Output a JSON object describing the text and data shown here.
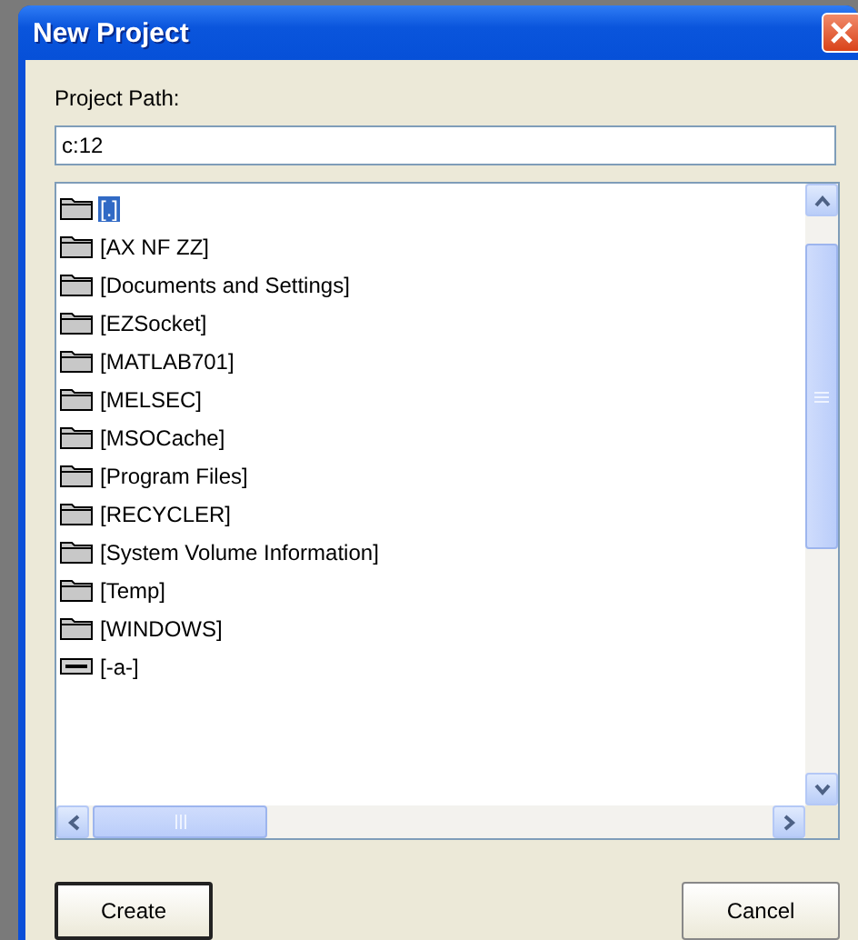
{
  "window": {
    "title": "New Project"
  },
  "path_field": {
    "label": "Project Path:",
    "value": "c:12"
  },
  "folders": [
    {
      "name": "[.]",
      "kind": "folder",
      "selected": true
    },
    {
      "name": "[AX NF ZZ]",
      "kind": "folder",
      "selected": false
    },
    {
      "name": "[Documents and Settings]",
      "kind": "folder",
      "selected": false
    },
    {
      "name": "[EZSocket]",
      "kind": "folder",
      "selected": false
    },
    {
      "name": "[MATLAB701]",
      "kind": "folder",
      "selected": false
    },
    {
      "name": "[MELSEC]",
      "kind": "folder",
      "selected": false
    },
    {
      "name": "[MSOCache]",
      "kind": "folder",
      "selected": false
    },
    {
      "name": "[Program Files]",
      "kind": "folder",
      "selected": false
    },
    {
      "name": "[RECYCLER]",
      "kind": "folder",
      "selected": false
    },
    {
      "name": "[System Volume Information]",
      "kind": "folder",
      "selected": false
    },
    {
      "name": "[Temp]",
      "kind": "folder",
      "selected": false
    },
    {
      "name": "[WINDOWS]",
      "kind": "folder",
      "selected": false
    },
    {
      "name": "[-a-]",
      "kind": "drive",
      "selected": false
    }
  ],
  "buttons": [
    {
      "label": "Create",
      "default": true
    },
    {
      "label": "Cancel",
      "default": false
    }
  ]
}
